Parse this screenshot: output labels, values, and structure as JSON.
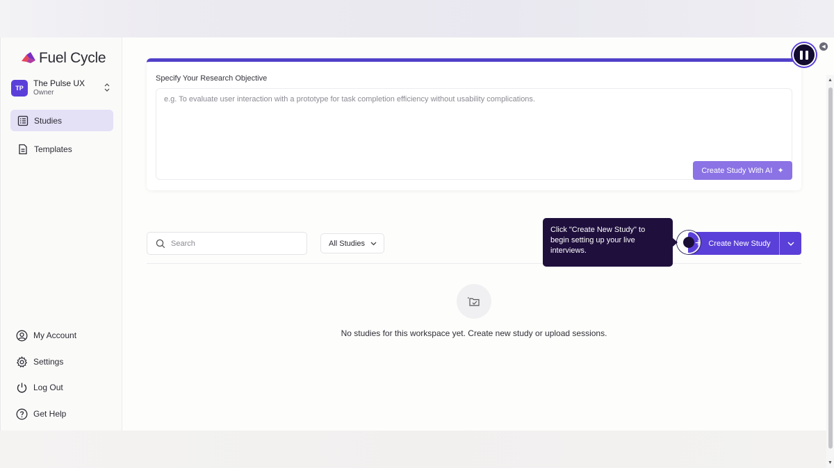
{
  "brand": {
    "name": "Fuel Cycle",
    "accent": "#5b3fd9",
    "logo_colors": [
      "#e8465a",
      "#7b2fbf"
    ]
  },
  "workspace": {
    "initials": "TP",
    "name": "The Pulse UX",
    "role": "Owner",
    "switch_icon": "updown-chevron-icon"
  },
  "sidebar": {
    "items": [
      {
        "label": "Studies",
        "icon": "list-icon",
        "active": true
      },
      {
        "label": "Templates",
        "icon": "document-icon",
        "active": false
      }
    ],
    "bottom_items": [
      {
        "label": "My Account",
        "icon": "user-circle-icon"
      },
      {
        "label": "Settings",
        "icon": "gear-icon"
      },
      {
        "label": "Log Out",
        "icon": "power-icon"
      },
      {
        "label": "Get Help",
        "icon": "help-circle-icon"
      }
    ]
  },
  "objective": {
    "label": "Specify Your Research Objective",
    "placeholder": "e.g. To evaluate user interaction with a prototype for task completion efficiency without usability complications.",
    "ai_button_label": "Create Study With AI",
    "ai_icon": "sparkle-icon"
  },
  "toolbar": {
    "search_placeholder": "Search",
    "filter_value": "All Studies",
    "create_label": "Create New Study"
  },
  "tooltip": {
    "text": "Click \"Create New Study\" to begin setting up your live interviews."
  },
  "empty_state": {
    "message": "No studies for this workspace yet. Create new study or upload sessions.",
    "icon": "folder-check-icon"
  },
  "recorder": {
    "state": "recording",
    "icon": "pause-icon"
  }
}
